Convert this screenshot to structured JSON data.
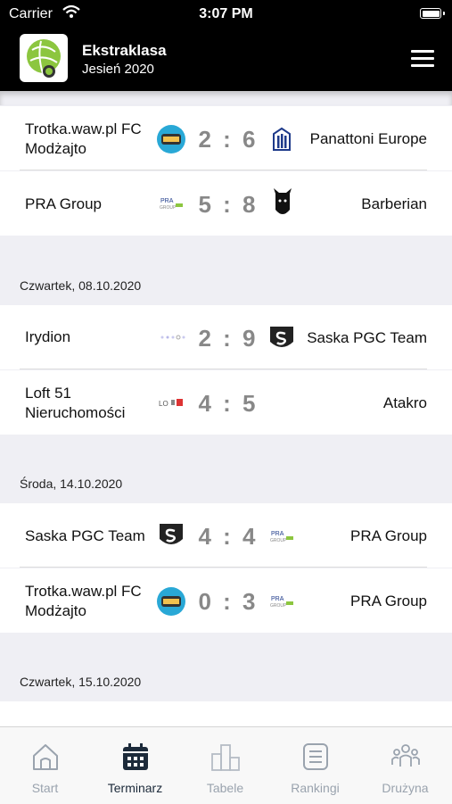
{
  "status_bar": {
    "carrier": "Carrier",
    "time": "3:07 PM"
  },
  "header": {
    "title": "Ekstraklasa",
    "subtitle": "Jesień 2020"
  },
  "sections": [
    {
      "date": "",
      "matches": [
        {
          "home": "Trotka.waw.pl FC Modżajto",
          "score": "2 : 6",
          "away": "Panattoni Europe"
        },
        {
          "home": "PRA Group",
          "score": "5 : 8",
          "away": "Barberian"
        }
      ]
    },
    {
      "date": "Czwartek, 08.10.2020",
      "matches": [
        {
          "home": "Irydion",
          "score": "2 : 9",
          "away": "Saska PGC Team"
        },
        {
          "home": "Loft 51 Nieruchomości",
          "score": "4 : 5",
          "away": "Atakro"
        }
      ]
    },
    {
      "date": "Środa, 14.10.2020",
      "matches": [
        {
          "home": "Saska PGC Team",
          "score": "4 : 4",
          "away": "PRA Group"
        },
        {
          "home": "Trotka.waw.pl FC Modżajto",
          "score": "0 : 3",
          "away": "PRA Group"
        }
      ]
    },
    {
      "date": "Czwartek, 15.10.2020",
      "matches": []
    }
  ],
  "tabbar": {
    "items": [
      {
        "label": "Start",
        "icon": "house-icon"
      },
      {
        "label": "Terminarz",
        "icon": "calendar-icon",
        "active": true
      },
      {
        "label": "Tabele",
        "icon": "podium-icon"
      },
      {
        "label": "Rankingi",
        "icon": "list-icon"
      },
      {
        "label": "Drużyna",
        "icon": "team-icon"
      }
    ]
  },
  "colors": {
    "header_bg": "#000000",
    "score_text": "#888888",
    "active_tab": "#1c2a3a",
    "inactive_tab": "#9aa3ae"
  }
}
